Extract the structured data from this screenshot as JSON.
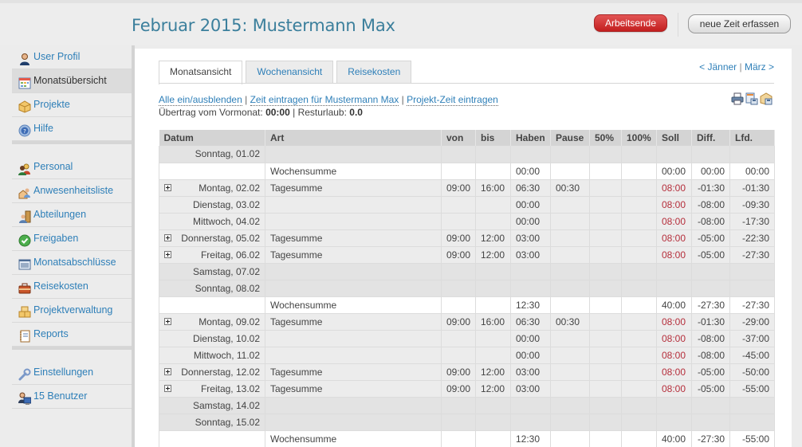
{
  "header": {
    "title": "Februar 2015: Mustermann Max",
    "end_button": "Arbeitsende",
    "new_time_button": "neue Zeit erfassen",
    "colors": {
      "title": "#3b7f9c",
      "end_button": "#c31f1f",
      "link": "#2e7fb8",
      "soll_red": "#b52e3b"
    }
  },
  "sidebar": {
    "groups": [
      [
        {
          "label": "User Profil",
          "icon": "user-icon",
          "active": false
        },
        {
          "label": "Monatsübersicht",
          "icon": "calendar-icon",
          "active": true
        },
        {
          "label": "Projekte",
          "icon": "package-icon",
          "active": false
        },
        {
          "label": "Hilfe",
          "icon": "help-icon",
          "active": false
        }
      ],
      [
        {
          "label": "Personal",
          "icon": "people-icon",
          "active": false
        },
        {
          "label": "Anwesenheitsliste",
          "icon": "attendance-icon",
          "active": false
        },
        {
          "label": "Abteilungen",
          "icon": "department-icon",
          "active": false
        },
        {
          "label": "Freigaben",
          "icon": "approval-check-icon",
          "active": false
        },
        {
          "label": "Monatsabschlüsse",
          "icon": "list-icon",
          "active": false
        },
        {
          "label": "Reisekosten",
          "icon": "briefcase-icon",
          "active": false
        },
        {
          "label": "Projektverwaltung",
          "icon": "packages-icon",
          "active": false
        },
        {
          "label": "Reports",
          "icon": "report-icon",
          "active": false
        }
      ],
      [
        {
          "label": "Einstellungen",
          "icon": "wrench-icon",
          "active": false
        },
        {
          "label": "15 Benutzer",
          "icon": "user-computer-icon",
          "active": false
        }
      ]
    ]
  },
  "tabs": [
    {
      "label": "Monatsansicht",
      "active": true
    },
    {
      "label": "Wochenansicht",
      "active": false
    },
    {
      "label": "Reisekosten",
      "active": false
    }
  ],
  "month_nav": {
    "prev": "< Jänner",
    "separator": "|",
    "next": "März >"
  },
  "actions": {
    "toggle_all": "Alle ein/ausblenden",
    "enter_time": "Zeit eintragen für Mustermann Max",
    "enter_project_time": "Projekt-Zeit eintragen",
    "separator": "|"
  },
  "carryover": {
    "label": "Übertrag vom Vormonat:",
    "value": "00:00",
    "vacation_label": "| Resturlaub:",
    "vacation_value": "0.0"
  },
  "toolbar_icons": [
    "print-icon",
    "export-spreadsheet-icon",
    "export-package-icon"
  ],
  "table": {
    "columns": [
      "Datum",
      "Art",
      "von",
      "bis",
      "Haben",
      "Pause",
      "50%",
      "100%",
      "Soll",
      "Diff.",
      "Lfd."
    ],
    "rows": [
      {
        "type": "weekend",
        "expand": false,
        "datum": "Sonntag, 01.02",
        "art": "",
        "von": "",
        "bis": "",
        "haben": "",
        "pause": "",
        "p50": "",
        "p100": "",
        "soll": "",
        "diff": "",
        "lfd": ""
      },
      {
        "type": "week",
        "expand": false,
        "datum": "",
        "art": "Wochensumme",
        "von": "",
        "bis": "",
        "haben": "00:00",
        "pause": "",
        "p50": "",
        "p100": "",
        "soll": "00:00",
        "diff": "00:00",
        "lfd": "00:00"
      },
      {
        "type": "day",
        "expand": true,
        "datum": "Montag, 02.02",
        "art": "Tagesumme",
        "von": "09:00",
        "bis": "16:00",
        "haben": "06:30",
        "pause": "00:30",
        "p50": "",
        "p100": "",
        "soll": "08:00",
        "diff": "-01:30",
        "lfd": "-01:30"
      },
      {
        "type": "day",
        "expand": false,
        "datum": "Dienstag, 03.02",
        "art": "",
        "von": "",
        "bis": "",
        "haben": "00:00",
        "pause": "",
        "p50": "",
        "p100": "",
        "soll": "08:00",
        "diff": "-08:00",
        "lfd": "-09:30"
      },
      {
        "type": "day",
        "expand": false,
        "datum": "Mittwoch, 04.02",
        "art": "",
        "von": "",
        "bis": "",
        "haben": "00:00",
        "pause": "",
        "p50": "",
        "p100": "",
        "soll": "08:00",
        "diff": "-08:00",
        "lfd": "-17:30"
      },
      {
        "type": "day",
        "expand": true,
        "datum": "Donnerstag, 05.02",
        "art": "Tagesumme",
        "von": "09:00",
        "bis": "12:00",
        "haben": "03:00",
        "pause": "",
        "p50": "",
        "p100": "",
        "soll": "08:00",
        "diff": "-05:00",
        "lfd": "-22:30"
      },
      {
        "type": "day",
        "expand": true,
        "datum": "Freitag, 06.02",
        "art": "Tagesumme",
        "von": "09:00",
        "bis": "12:00",
        "haben": "03:00",
        "pause": "",
        "p50": "",
        "p100": "",
        "soll": "08:00",
        "diff": "-05:00",
        "lfd": "-27:30"
      },
      {
        "type": "weekend",
        "expand": false,
        "datum": "Samstag, 07.02",
        "art": "",
        "von": "",
        "bis": "",
        "haben": "",
        "pause": "",
        "p50": "",
        "p100": "",
        "soll": "",
        "diff": "",
        "lfd": ""
      },
      {
        "type": "weekend",
        "expand": false,
        "datum": "Sonntag, 08.02",
        "art": "",
        "von": "",
        "bis": "",
        "haben": "",
        "pause": "",
        "p50": "",
        "p100": "",
        "soll": "",
        "diff": "",
        "lfd": ""
      },
      {
        "type": "week",
        "expand": false,
        "datum": "",
        "art": "Wochensumme",
        "von": "",
        "bis": "",
        "haben": "12:30",
        "pause": "",
        "p50": "",
        "p100": "",
        "soll": "40:00",
        "diff": "-27:30",
        "lfd": "-27:30"
      },
      {
        "type": "day",
        "expand": true,
        "datum": "Montag, 09.02",
        "art": "Tagesumme",
        "von": "09:00",
        "bis": "16:00",
        "haben": "06:30",
        "pause": "00:30",
        "p50": "",
        "p100": "",
        "soll": "08:00",
        "diff": "-01:30",
        "lfd": "-29:00"
      },
      {
        "type": "day",
        "expand": false,
        "datum": "Dienstag, 10.02",
        "art": "",
        "von": "",
        "bis": "",
        "haben": "00:00",
        "pause": "",
        "p50": "",
        "p100": "",
        "soll": "08:00",
        "diff": "-08:00",
        "lfd": "-37:00"
      },
      {
        "type": "day",
        "expand": false,
        "datum": "Mittwoch, 11.02",
        "art": "",
        "von": "",
        "bis": "",
        "haben": "00:00",
        "pause": "",
        "p50": "",
        "p100": "",
        "soll": "08:00",
        "diff": "-08:00",
        "lfd": "-45:00"
      },
      {
        "type": "day",
        "expand": true,
        "datum": "Donnerstag, 12.02",
        "art": "Tagesumme",
        "von": "09:00",
        "bis": "12:00",
        "haben": "03:00",
        "pause": "",
        "p50": "",
        "p100": "",
        "soll": "08:00",
        "diff": "-05:00",
        "lfd": "-50:00"
      },
      {
        "type": "day",
        "expand": true,
        "datum": "Freitag, 13.02",
        "art": "Tagesumme",
        "von": "09:00",
        "bis": "12:00",
        "haben": "03:00",
        "pause": "",
        "p50": "",
        "p100": "",
        "soll": "08:00",
        "diff": "-05:00",
        "lfd": "-55:00"
      },
      {
        "type": "weekend",
        "expand": false,
        "datum": "Samstag, 14.02",
        "art": "",
        "von": "",
        "bis": "",
        "haben": "",
        "pause": "",
        "p50": "",
        "p100": "",
        "soll": "",
        "diff": "",
        "lfd": ""
      },
      {
        "type": "weekend",
        "expand": false,
        "datum": "Sonntag, 15.02",
        "art": "",
        "von": "",
        "bis": "",
        "haben": "",
        "pause": "",
        "p50": "",
        "p100": "",
        "soll": "",
        "diff": "",
        "lfd": ""
      },
      {
        "type": "week",
        "expand": false,
        "datum": "",
        "art": "Wochensumme",
        "von": "",
        "bis": "",
        "haben": "12:30",
        "pause": "",
        "p50": "",
        "p100": "",
        "soll": "40:00",
        "diff": "-27:30",
        "lfd": "-55:00"
      }
    ]
  }
}
